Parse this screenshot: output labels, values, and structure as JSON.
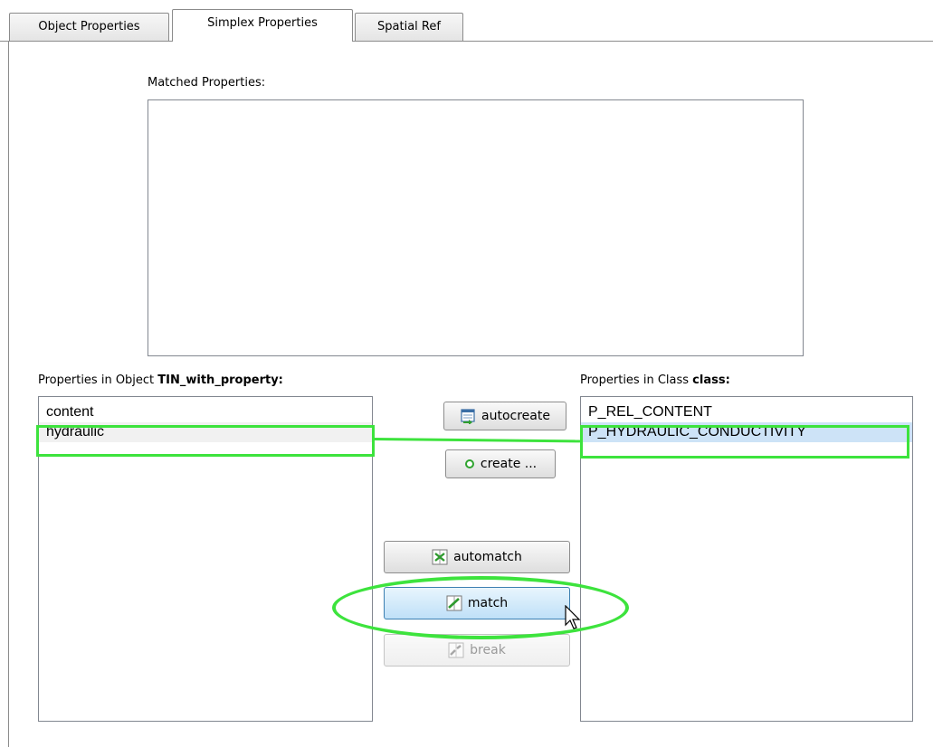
{
  "tabs": [
    {
      "label": "Object Properties",
      "active": false
    },
    {
      "label": "Simplex Properties",
      "active": true
    },
    {
      "label": "Spatial Ref",
      "active": false
    }
  ],
  "matched": {
    "label": "Matched Properties:"
  },
  "object_props": {
    "label_prefix": "Properties in Object ",
    "object_name": "TIN_with_property:",
    "items": [
      "content",
      "hydraulic"
    ]
  },
  "class_props": {
    "label_prefix": "Properties in Class ",
    "class_name": "class:",
    "items": [
      "P_REL_CONTENT",
      "P_HYDRAULIC_CONDUCTIVITY"
    ]
  },
  "buttons": {
    "autocreate": "autocreate",
    "create": "create ...",
    "automatch": "automatch",
    "match": "match",
    "break": "break"
  },
  "colors": {
    "highlight": "#3de33d",
    "selection_blue": "#cde3f7",
    "border": "#828790"
  },
  "icons": {
    "autocreate": "autocreate-icon",
    "create": "create-dot-icon",
    "automatch": "automatch-icon",
    "match": "match-icon",
    "break": "break-icon",
    "cursor": "mouse-cursor"
  }
}
